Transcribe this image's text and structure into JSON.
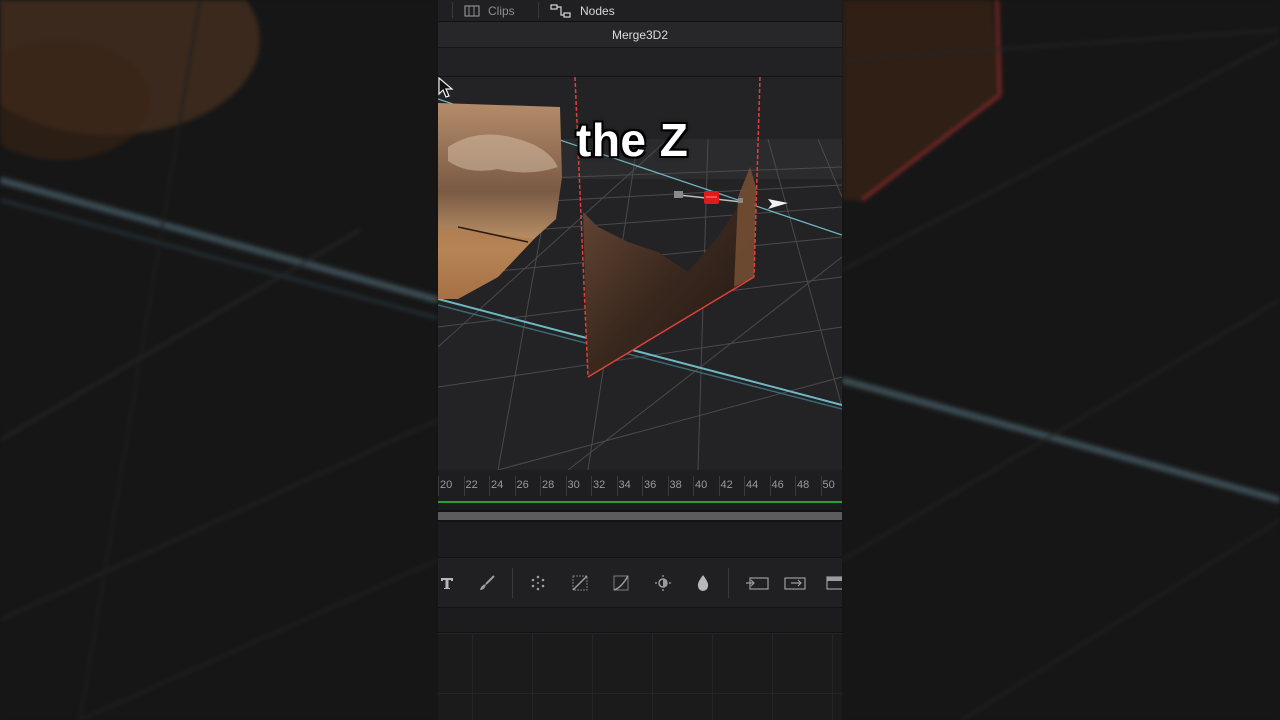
{
  "topbar": {
    "tabs": [
      {
        "label": "Clips",
        "icon": "filmstrip-icon"
      },
      {
        "label": "Nodes",
        "icon": "node-graph-icon",
        "active": true
      }
    ]
  },
  "viewer": {
    "title": "Merge3D2"
  },
  "overlay": {
    "caption": "the Z"
  },
  "timeline": {
    "ticks": [
      "20",
      "22",
      "24",
      "26",
      "28",
      "30",
      "32",
      "34",
      "36",
      "38",
      "40",
      "42",
      "44",
      "46",
      "48",
      "50"
    ]
  },
  "toolbar": {
    "tools": [
      "text-icon",
      "paint-brush-icon",
      "particles-icon",
      "color-curves-icon",
      "curves-icon",
      "brightness-icon",
      "droplet-icon",
      "loader-icon",
      "merge-icon",
      "saver-icon"
    ]
  },
  "colors": {
    "accent_red": "#e0403a",
    "playhead_green": "#2e9b3a",
    "panel_bg": "#1c1c1e"
  }
}
